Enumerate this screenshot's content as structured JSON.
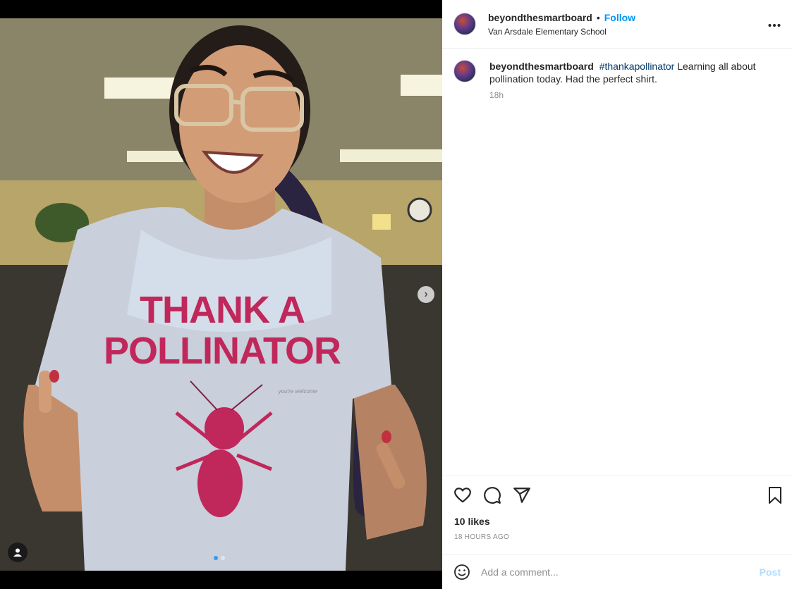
{
  "post": {
    "username": "beyondthesmartboard",
    "separator": "•",
    "follow_label": "Follow",
    "location": "Van Arsdale Elementary School",
    "more_label": "•••"
  },
  "caption": {
    "username": "beyondthesmartboard",
    "hashtag": "#thankapollinator",
    "text": " Learning all about pollination today. Had the perfect shirt.",
    "time": "18h"
  },
  "photo": {
    "shirt_line1": "THANK A",
    "shirt_line2": "POLLINATOR",
    "shirt_small": "you're welcome",
    "next_label": "›",
    "carousel_count": 2,
    "carousel_active": 1
  },
  "engagement": {
    "likes": "10 likes",
    "age": "18 HOURS AGO"
  },
  "comment": {
    "placeholder": "Add a comment...",
    "post_label": "Post"
  },
  "colors": {
    "follow": "#0095f6",
    "hashtag": "#00376b",
    "post_disabled": "#b3dbff",
    "shirt_text": "#c0275b"
  }
}
